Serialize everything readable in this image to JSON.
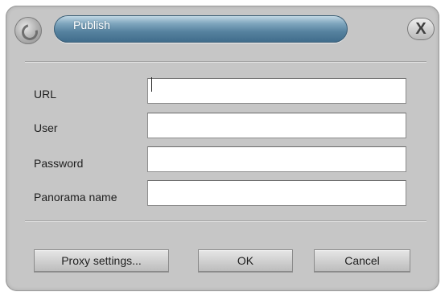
{
  "dialog": {
    "title": "Publish",
    "close_label": "X"
  },
  "form": {
    "url_label": "URL",
    "url_value": "",
    "user_label": "User",
    "user_value": "",
    "password_label": "Password",
    "password_value": "",
    "panorama_label": "Panorama name",
    "panorama_value": ""
  },
  "buttons": {
    "proxy_label": "Proxy settings...",
    "ok_label": "OK",
    "cancel_label": "Cancel"
  }
}
